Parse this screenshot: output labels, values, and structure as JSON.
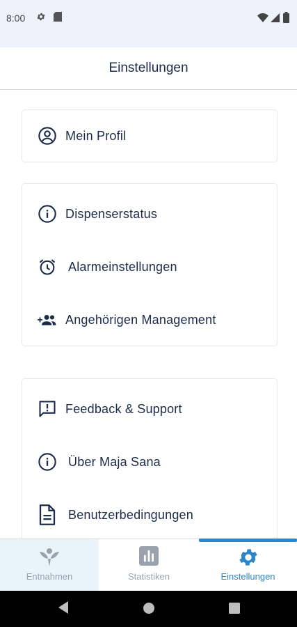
{
  "status_bar": {
    "time": "8:00",
    "icons": [
      "settings-icon",
      "sd-card-icon",
      "wifi-icon",
      "signal-icon",
      "battery-icon"
    ]
  },
  "header": {
    "title": "Einstellungen"
  },
  "cards": [
    {
      "items": [
        {
          "label": "Mein Profil",
          "icon": "account-circle-icon"
        }
      ]
    },
    {
      "items": [
        {
          "label": "Dispenserstatus",
          "icon": "info-icon"
        },
        {
          "label": "Alarmeinstellungen",
          "icon": "alarm-icon"
        },
        {
          "label": "Angehörigen Management",
          "icon": "group-add-icon"
        }
      ]
    },
    {
      "items": [
        {
          "label": "Feedback & Support",
          "icon": "feedback-icon"
        },
        {
          "label": "Über Maja Sana",
          "icon": "info-icon"
        },
        {
          "label": "Benutzerbedingungen",
          "icon": "document-icon"
        }
      ]
    }
  ],
  "bottom_nav": {
    "items": [
      {
        "label": "Entnahmen",
        "icon": "leaf-person-icon",
        "active": false
      },
      {
        "label": "Statistiken",
        "icon": "bar-chart-icon",
        "active": false
      },
      {
        "label": "Einstellungen",
        "icon": "gear-icon",
        "active": true
      }
    ]
  },
  "colors": {
    "primary_text": "#1c2b4a",
    "accent": "#2b87c9",
    "inactive": "#9aa3ad",
    "status_bar_bg": "#eef3fb",
    "nav_highlight_bg": "#e8f3fa"
  }
}
